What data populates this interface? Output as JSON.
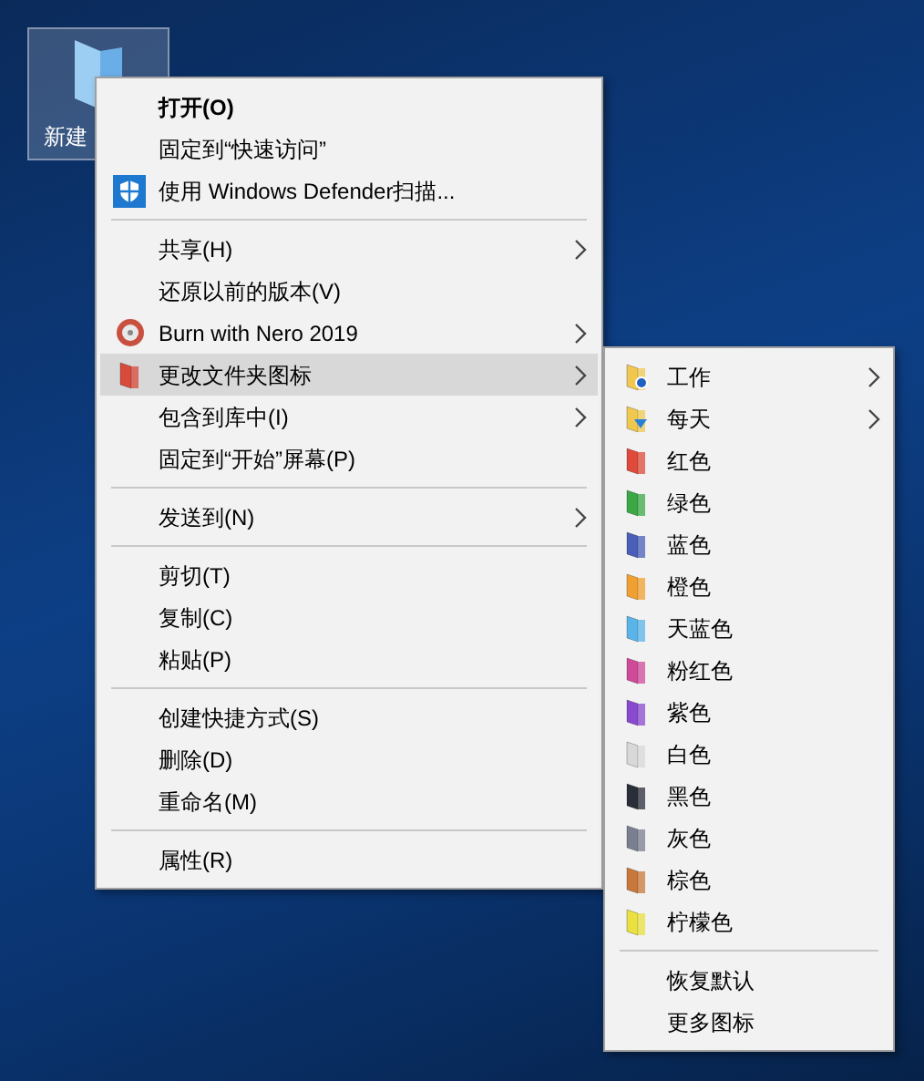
{
  "desktop_icon": {
    "label": "新建",
    "selected": true
  },
  "context_menu": {
    "items": [
      {
        "kind": "item",
        "label": "打开(O)",
        "bold": true,
        "submenu": false,
        "selected": false
      },
      {
        "kind": "item",
        "label": "固定到“快速访问”",
        "bold": false,
        "submenu": false,
        "selected": false
      },
      {
        "kind": "item",
        "label": "使用 Windows Defender扫描...",
        "bold": false,
        "submenu": false,
        "selected": false
      },
      {
        "kind": "separator"
      },
      {
        "kind": "item",
        "label": "共享(H)",
        "bold": false,
        "submenu": true,
        "selected": false
      },
      {
        "kind": "item",
        "label": "还原以前的版本(V)",
        "bold": false,
        "submenu": false,
        "selected": false
      },
      {
        "kind": "item",
        "label": "Burn with Nero 2019",
        "bold": false,
        "submenu": true,
        "selected": false
      },
      {
        "kind": "item",
        "label": "更改文件夹图标",
        "bold": false,
        "submenu": true,
        "selected": true
      },
      {
        "kind": "item",
        "label": "包含到库中(I)",
        "bold": false,
        "submenu": true,
        "selected": false
      },
      {
        "kind": "item",
        "label": "固定到“开始”屏幕(P)",
        "bold": false,
        "submenu": false,
        "selected": false
      },
      {
        "kind": "separator"
      },
      {
        "kind": "item",
        "label": "发送到(N)",
        "bold": false,
        "submenu": true,
        "selected": false
      },
      {
        "kind": "separator"
      },
      {
        "kind": "item",
        "label": "剪切(T)",
        "bold": false,
        "submenu": false,
        "selected": false
      },
      {
        "kind": "item",
        "label": "复制(C)",
        "bold": false,
        "submenu": false,
        "selected": false
      },
      {
        "kind": "item",
        "label": "粘贴(P)",
        "bold": false,
        "submenu": false,
        "selected": false
      },
      {
        "kind": "separator"
      },
      {
        "kind": "item",
        "label": "创建快捷方式(S)",
        "bold": false,
        "submenu": false,
        "selected": false
      },
      {
        "kind": "item",
        "label": "删除(D)",
        "bold": false,
        "submenu": false,
        "selected": false
      },
      {
        "kind": "item",
        "label": "重命名(M)",
        "bold": false,
        "submenu": false,
        "selected": false
      },
      {
        "kind": "separator"
      },
      {
        "kind": "item",
        "label": "属性(R)",
        "bold": false,
        "submenu": false,
        "selected": false
      }
    ]
  },
  "submenu": {
    "items": [
      {
        "kind": "item",
        "label": "工作",
        "color": "#f0c850",
        "submenu": true
      },
      {
        "kind": "item",
        "label": "每天",
        "color": "#f0c850",
        "submenu": true
      },
      {
        "kind": "item",
        "label": "红色",
        "color": "#e04a3a",
        "submenu": false
      },
      {
        "kind": "item",
        "label": "绿色",
        "color": "#3aa845",
        "submenu": false
      },
      {
        "kind": "item",
        "label": "蓝色",
        "color": "#4a5fb8",
        "submenu": false
      },
      {
        "kind": "item",
        "label": "橙色",
        "color": "#f0a030",
        "submenu": false
      },
      {
        "kind": "item",
        "label": "天蓝色",
        "color": "#5ab4e8",
        "submenu": false
      },
      {
        "kind": "item",
        "label": "粉红色",
        "color": "#d04a9a",
        "submenu": false
      },
      {
        "kind": "item",
        "label": "紫色",
        "color": "#8a4ad0",
        "submenu": false
      },
      {
        "kind": "item",
        "label": "白色",
        "color": "#d8d8d8",
        "submenu": false
      },
      {
        "kind": "item",
        "label": "黑色",
        "color": "#2a2e38",
        "submenu": false
      },
      {
        "kind": "item",
        "label": "灰色",
        "color": "#7a7f90",
        "submenu": false
      },
      {
        "kind": "item",
        "label": "棕色",
        "color": "#c8783a",
        "submenu": false
      },
      {
        "kind": "item",
        "label": "柠檬色",
        "color": "#eae040",
        "submenu": false
      },
      {
        "kind": "separator"
      },
      {
        "kind": "item",
        "label": "恢复默认",
        "submenu": false
      },
      {
        "kind": "item",
        "label": "更多图标",
        "submenu": false
      }
    ]
  }
}
